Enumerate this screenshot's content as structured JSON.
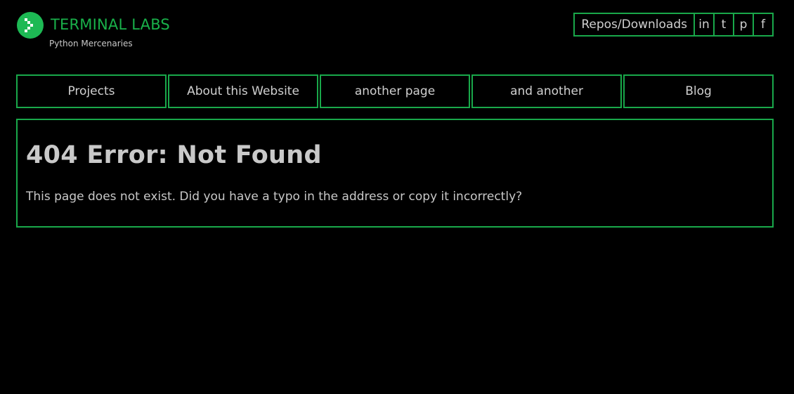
{
  "header": {
    "brand": "TERMINAL LABS",
    "tagline": "Python Mercenaries",
    "logo_icon": "chevron-right-pixel-icon"
  },
  "top_links": [
    {
      "label": "Repos/Downloads"
    },
    {
      "label": "in"
    },
    {
      "label": "t"
    },
    {
      "label": "p"
    },
    {
      "label": "f"
    }
  ],
  "nav": [
    {
      "label": "Projects"
    },
    {
      "label": "About this Website"
    },
    {
      "label": "another page"
    },
    {
      "label": "and another"
    },
    {
      "label": "Blog"
    }
  ],
  "main": {
    "title": "404 Error: Not Found",
    "message": "This page does not exist. Did you have a typo in the address or copy it incorrectly?"
  },
  "colors": {
    "background": "#000000",
    "accent": "#19a84a",
    "brand": "#19b14a",
    "text": "#c8c8c8"
  }
}
